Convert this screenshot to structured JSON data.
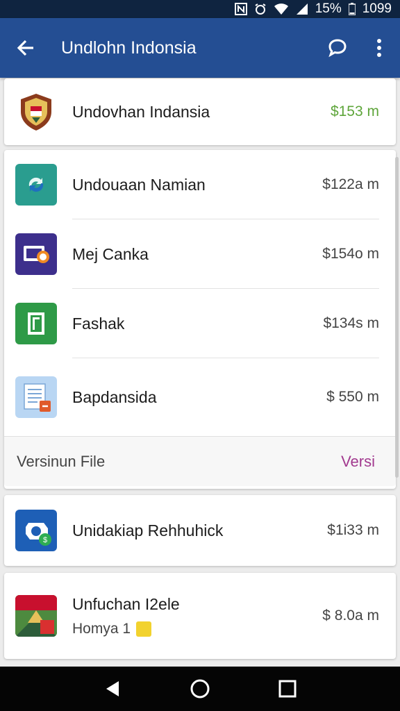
{
  "status_bar": {
    "battery": "15%",
    "time": "1099"
  },
  "app_bar": {
    "title": "Undlohn Indonsia"
  },
  "top_item": {
    "name": "Undovhan Indansia",
    "size": "$153 m",
    "icon": "shield-crest-icon",
    "size_color": "#5ea53a"
  },
  "list": [
    {
      "name": "Undouaan Namian",
      "size": "$122a m",
      "icon": "sync-icon",
      "color": "#2a9d8f"
    },
    {
      "name": "Mej Canka",
      "size": "$154o m",
      "icon": "video-chat-icon",
      "color": "#3d2f8c"
    },
    {
      "name": "Fashak",
      "size": "$134s m",
      "icon": "document-icon",
      "color": "#2e9a47"
    },
    {
      "name": "Bapdansida",
      "size": "$ 550 m",
      "icon": "file-icon",
      "color": "#8bb8e8"
    }
  ],
  "list_footer": {
    "label": "Versinun File",
    "action": "Versi"
  },
  "card_item": {
    "name": "Unidakiap Rehhuhick",
    "size": "$1i33 m",
    "icon": "camera-icon",
    "color": "#1e5fb6"
  },
  "last_item": {
    "name": "Unfuchan I2ele",
    "sub": "Homya 1",
    "size": "$ 8.0a m",
    "icon": "game-icon"
  },
  "accent": "#244e93"
}
